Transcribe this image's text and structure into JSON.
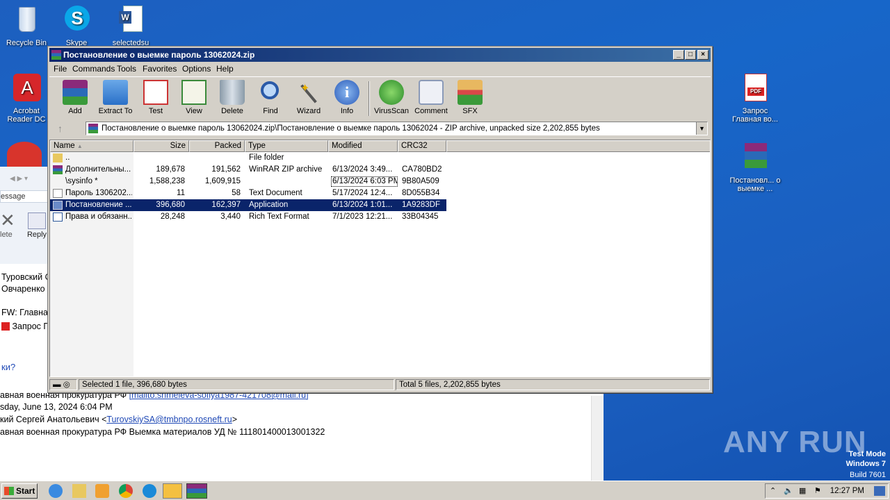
{
  "desktop": {
    "icons": [
      {
        "label": "Recycle Bin"
      },
      {
        "label": "Skype"
      },
      {
        "label": "selectedsu"
      },
      {
        "label": "Acrobat Reader DC"
      },
      {
        "label": "Запрос Главная во..."
      },
      {
        "label": "Постановл... о выемке ..."
      }
    ],
    "watermark": "ANY RUN",
    "testmode": {
      "line1": "Test Mode",
      "line2": "Windows 7",
      "line3": "Build 7601"
    }
  },
  "mail": {
    "toolbar": {
      "delete_label": "lete",
      "reply_label": "Reply",
      "tab_label": "essage"
    },
    "recipients": [
      "Туровский С",
      "Овчаренко В"
    ],
    "subject": "FW: Главная",
    "attachment": "Запрос Г",
    "question": "ки?",
    "lines": [
      {
        "prefix": "авная военная прокуратура РФ ",
        "link": "[mailto:shmeleva-sofiya1987-421708@mail.ru]"
      },
      {
        "text": "sday, June 13, 2024 6:04 PM"
      },
      {
        "prefix": "кий Сергей Анатольевич <",
        "link": "TurovskiySA@tmbnpo.rosneft.ru",
        "suffix": ">"
      },
      {
        "text": "авная военная прокуратура РФ Выемка материалов УД № 111801400013001322"
      }
    ]
  },
  "rar": {
    "title": "Постановление о выемке  пароль 13062024.zip",
    "menu": [
      "File",
      "Commands",
      "Tools",
      "Favorites",
      "Options",
      "Help"
    ],
    "toolbar": [
      "Add",
      "Extract To",
      "Test",
      "View",
      "Delete",
      "Find",
      "Wizard",
      "Info",
      "VirusScan",
      "Comment",
      "SFX"
    ],
    "address": "Постановление о выемке  пароль 13062024.zip\\Постановление о выемке  пароль 13062024 - ZIP archive, unpacked size 2,202,855 bytes",
    "columns": {
      "name": "Name",
      "size": "Size",
      "packed": "Packed",
      "type": "Type",
      "modified": "Modified",
      "crc": "CRC32"
    },
    "rows": [
      {
        "name": "..",
        "size": "",
        "packed": "",
        "type": "File folder",
        "modified": "",
        "crc": ""
      },
      {
        "name": "Дополнительны...",
        "size": "189,678",
        "packed": "191,562",
        "type": "WinRAR ZIP archive",
        "modified": "6/13/2024 3:49...",
        "crc": "CA780BD2"
      },
      {
        "name": "\\sysinfo *",
        "size": "1,588,238",
        "packed": "1,609,915",
        "type": "",
        "modified": "6/13/2024 6:03 PM",
        "crc": "9B80A509"
      },
      {
        "name": "Пароль 1306202...",
        "size": "11",
        "packed": "58",
        "type": "Text Document",
        "modified": "5/17/2024 12:4...",
        "crc": "8D055B34"
      },
      {
        "name": "Постановление ...",
        "size": "396,680",
        "packed": "162,397",
        "type": "Application",
        "modified": "6/13/2024 1:01...",
        "crc": "1A9283DF"
      },
      {
        "name": "Права и обязанн...",
        "size": "28,248",
        "packed": "3,440",
        "type": "Rich Text Format",
        "modified": "7/1/2023 12:21...",
        "crc": "33B04345"
      }
    ],
    "status_left": "Selected 1 file, 396,680 bytes",
    "status_right": "Total 5 files, 2,202,855 bytes"
  },
  "taskbar": {
    "start": "Start",
    "clock": "12:27 PM"
  }
}
